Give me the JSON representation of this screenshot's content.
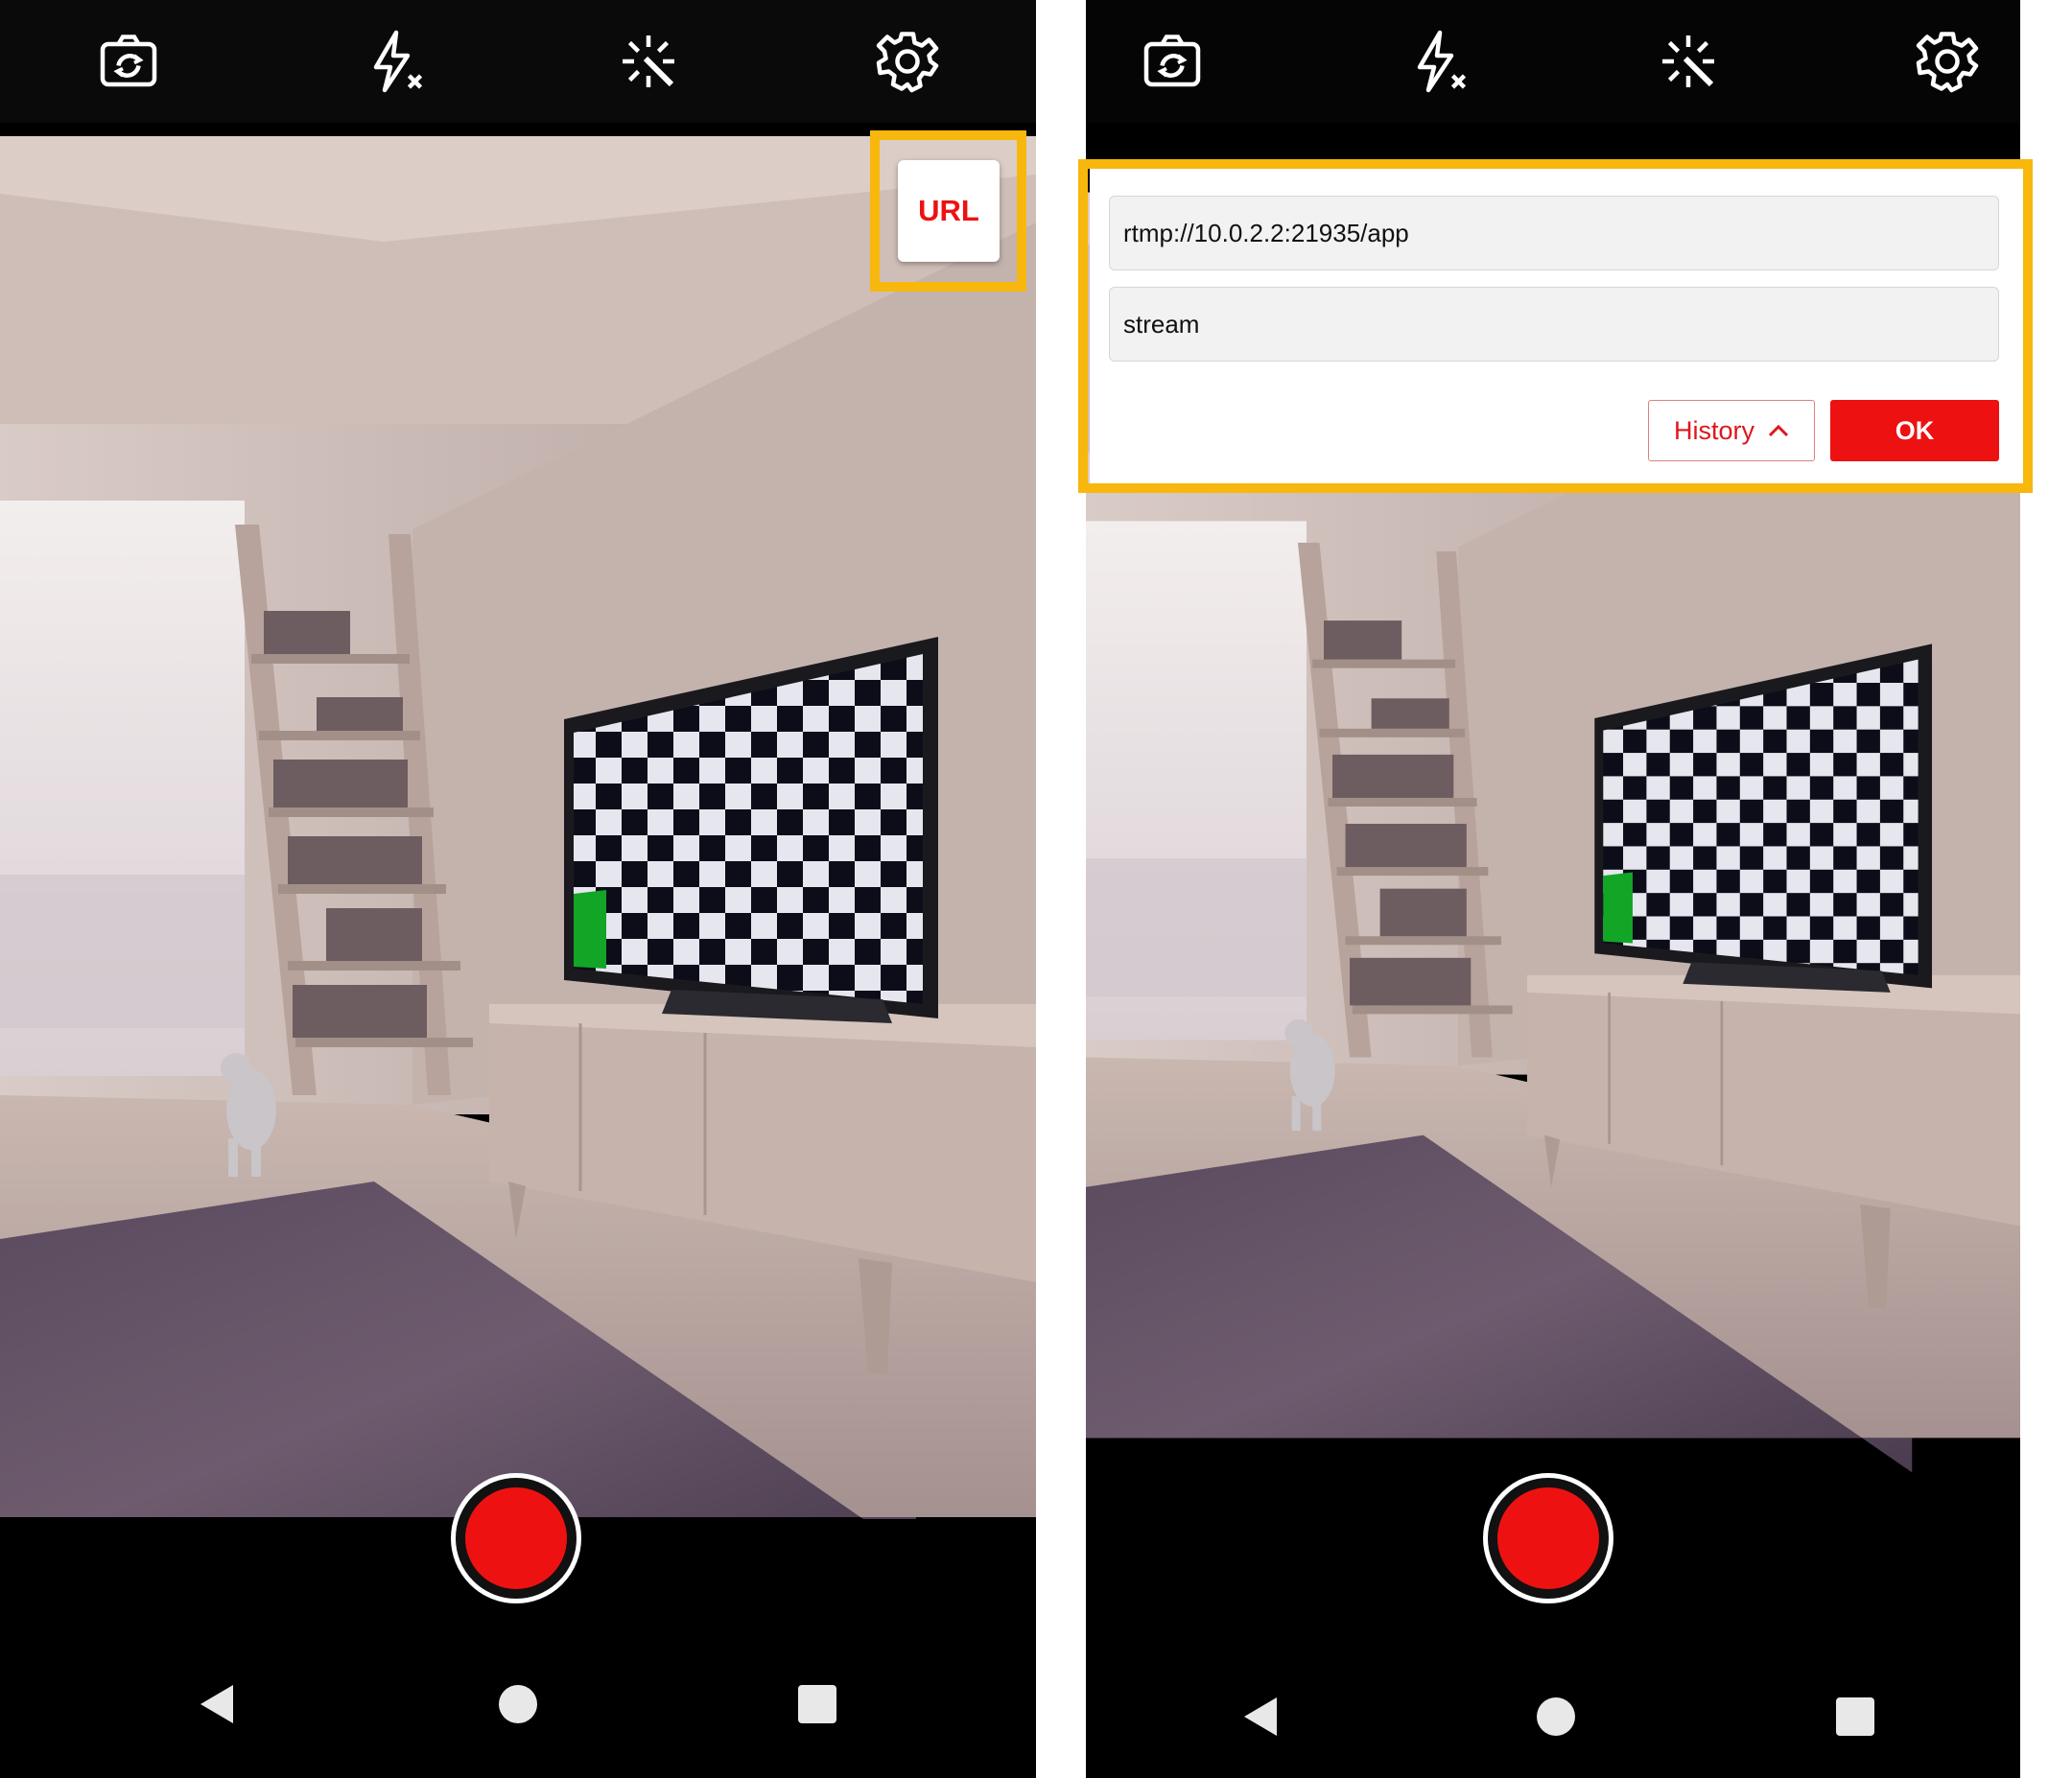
{
  "colors": {
    "accent": "#ee1111",
    "highlight": "#f8b70d",
    "topbar": "#0a0a0a",
    "white": "#ffffff"
  },
  "toolbar": {
    "icons": [
      "switch-camera-icon",
      "flash-off-icon",
      "effects-icon",
      "settings-icon"
    ]
  },
  "left_screen": {
    "url_button_label": "URL"
  },
  "right_screen": {
    "dialog": {
      "url_value": "rtmp://10.0.2.2:21935/app",
      "stream_value": "stream",
      "history_label": "History",
      "ok_label": "OK"
    }
  },
  "navbar": {
    "icons": [
      "back-icon",
      "home-icon",
      "recents-icon"
    ]
  }
}
